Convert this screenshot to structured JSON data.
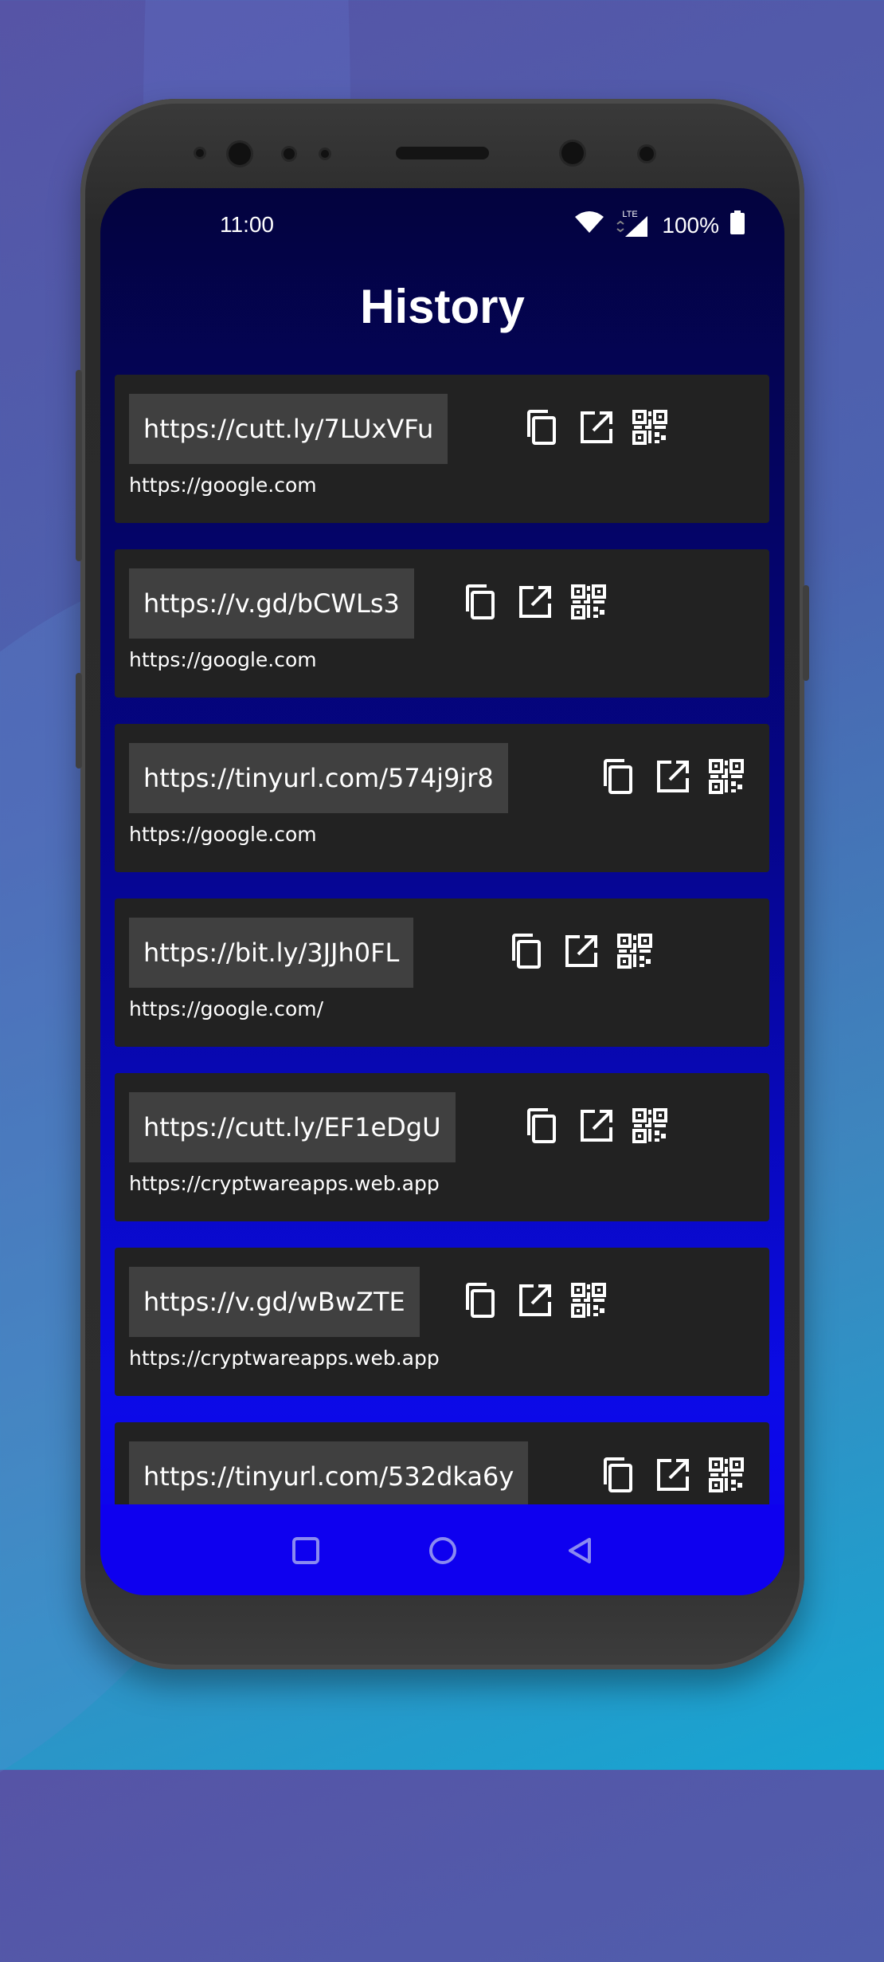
{
  "status_bar": {
    "time": "11:00",
    "network_label": "LTE",
    "battery_text": "100%",
    "icons": [
      "wifi-icon",
      "signal-icon",
      "battery-icon"
    ]
  },
  "page": {
    "title": "History"
  },
  "history": [
    {
      "short_url": "https://cutt.ly/7LUxVFu",
      "original_url": "https://google.com"
    },
    {
      "short_url": "https://v.gd/bCWLs3",
      "original_url": "https://google.com"
    },
    {
      "short_url": "https://tinyurl.com/574j9jr8",
      "original_url": "https://google.com"
    },
    {
      "short_url": "https://bit.ly/3JJh0FL",
      "original_url": "https://google.com/"
    },
    {
      "short_url": "https://cutt.ly/EF1eDgU",
      "original_url": "https://cryptwareapps.web.app"
    },
    {
      "short_url": "https://v.gd/wBwZTE",
      "original_url": "https://cryptwareapps.web.app"
    },
    {
      "short_url": "https://tinyurl.com/532dka6y",
      "original_url": ""
    }
  ],
  "item_actions": [
    "copy-icon",
    "open-external-icon",
    "qr-code-icon"
  ],
  "nav_bar": {
    "icons": [
      "recents-square-icon",
      "home-circle-icon",
      "back-triangle-icon"
    ]
  },
  "colors": {
    "screen_top": "#03033e",
    "screen_bottom": "#0f00f0",
    "card_bg": "#222222",
    "short_box_bg": "#404040",
    "text": "#ffffff"
  }
}
